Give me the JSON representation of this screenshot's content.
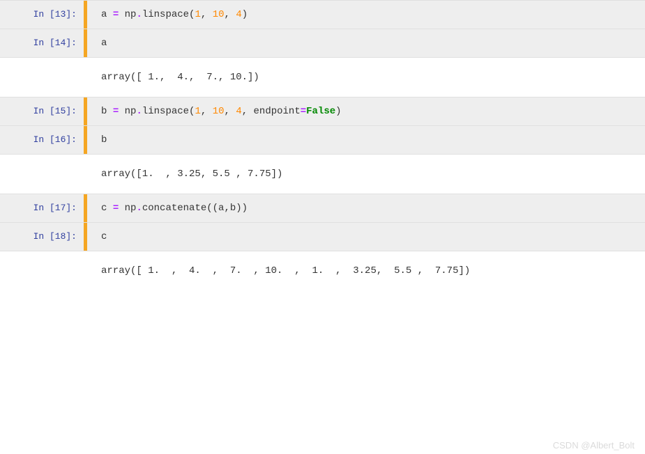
{
  "cells": [
    {
      "type": "input",
      "prompt": "In [13]:",
      "tokens": [
        {
          "t": "a ",
          "c": "tok-name"
        },
        {
          "t": "=",
          "c": "tok-op"
        },
        {
          "t": " np",
          "c": "tok-name"
        },
        {
          "t": ".",
          "c": "tok-op"
        },
        {
          "t": "linspace(",
          "c": "tok-name"
        },
        {
          "t": "1",
          "c": "tok-num"
        },
        {
          "t": ", ",
          "c": "tok-name"
        },
        {
          "t": "10",
          "c": "tok-num"
        },
        {
          "t": ", ",
          "c": "tok-name"
        },
        {
          "t": "4",
          "c": "tok-num"
        },
        {
          "t": ")",
          "c": "tok-name"
        }
      ]
    },
    {
      "type": "input",
      "prompt": "In [14]:",
      "tokens": [
        {
          "t": "a",
          "c": "tok-name"
        }
      ]
    },
    {
      "type": "output",
      "prompt": "",
      "text": "array([ 1.,  4.,  7., 10.])"
    },
    {
      "type": "input",
      "prompt": "In [15]:",
      "tokens": [
        {
          "t": "b ",
          "c": "tok-name"
        },
        {
          "t": "=",
          "c": "tok-op"
        },
        {
          "t": " np",
          "c": "tok-name"
        },
        {
          "t": ".",
          "c": "tok-op"
        },
        {
          "t": "linspace(",
          "c": "tok-name"
        },
        {
          "t": "1",
          "c": "tok-num"
        },
        {
          "t": ", ",
          "c": "tok-name"
        },
        {
          "t": "10",
          "c": "tok-num"
        },
        {
          "t": ", ",
          "c": "tok-name"
        },
        {
          "t": "4",
          "c": "tok-num"
        },
        {
          "t": ", endpoint",
          "c": "tok-name"
        },
        {
          "t": "=",
          "c": "tok-op"
        },
        {
          "t": "False",
          "c": "tok-kw"
        },
        {
          "t": ")",
          "c": "tok-name"
        }
      ]
    },
    {
      "type": "input",
      "prompt": "In [16]:",
      "tokens": [
        {
          "t": "b",
          "c": "tok-name"
        }
      ]
    },
    {
      "type": "output",
      "prompt": "",
      "text": "array([1.  , 3.25, 5.5 , 7.75])"
    },
    {
      "type": "input",
      "prompt": "In [17]:",
      "tokens": [
        {
          "t": "c ",
          "c": "tok-name"
        },
        {
          "t": "=",
          "c": "tok-op"
        },
        {
          "t": " np",
          "c": "tok-name"
        },
        {
          "t": ".",
          "c": "tok-op"
        },
        {
          "t": "concatenate((a,b))",
          "c": "tok-name"
        }
      ]
    },
    {
      "type": "input",
      "prompt": "In [18]:",
      "tokens": [
        {
          "t": "c",
          "c": "tok-name"
        }
      ]
    },
    {
      "type": "output",
      "prompt": "",
      "text": "array([ 1.  ,  4.  ,  7.  , 10.  ,  1.  ,  3.25,  5.5 ,  7.75])"
    }
  ],
  "watermark": "CSDN @Albert_Bolt"
}
